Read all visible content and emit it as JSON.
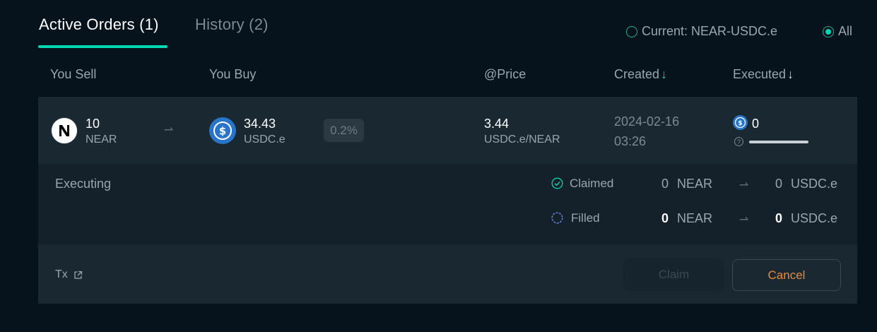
{
  "tabs": {
    "active_label": "Active Orders (1)",
    "history_label": "History (2)"
  },
  "filters": {
    "current_label": "Current: NEAR-USDC.e",
    "all_label": "All",
    "selected": "All"
  },
  "columns": {
    "sell": "You Sell",
    "buy": "You Buy",
    "price": "@Price",
    "created": "Created",
    "executed": "Executed"
  },
  "icons": {
    "sort_arrow": "↓",
    "swap_arrow": "⇀",
    "help": "?"
  },
  "order": {
    "sell_amount": "10",
    "sell_symbol": "NEAR",
    "buy_amount": "34.43",
    "buy_symbol": "USDC.e",
    "fee": "0.2%",
    "price_value": "3.44",
    "price_unit": "USDC.e/NEAR",
    "created_date": "2024-02-16",
    "created_time": "03:26",
    "executed_amount": "0",
    "executed_progress": 0,
    "status": "Executing",
    "claimed": {
      "label": "Claimed",
      "near_value": "0",
      "near_symbol": "NEAR",
      "usdc_value": "0",
      "usdc_symbol": "USDC.e"
    },
    "filled": {
      "label": "Filled",
      "near_value": "0",
      "near_symbol": "NEAR",
      "usdc_value": "0",
      "usdc_symbol": "USDC.e"
    },
    "tx_label": "Tx"
  },
  "actions": {
    "claim_label": "Claim",
    "cancel_label": "Cancel"
  },
  "colors": {
    "accent": "#00d6af",
    "cancel": "#e8893a",
    "usdc": "#2775ca"
  }
}
